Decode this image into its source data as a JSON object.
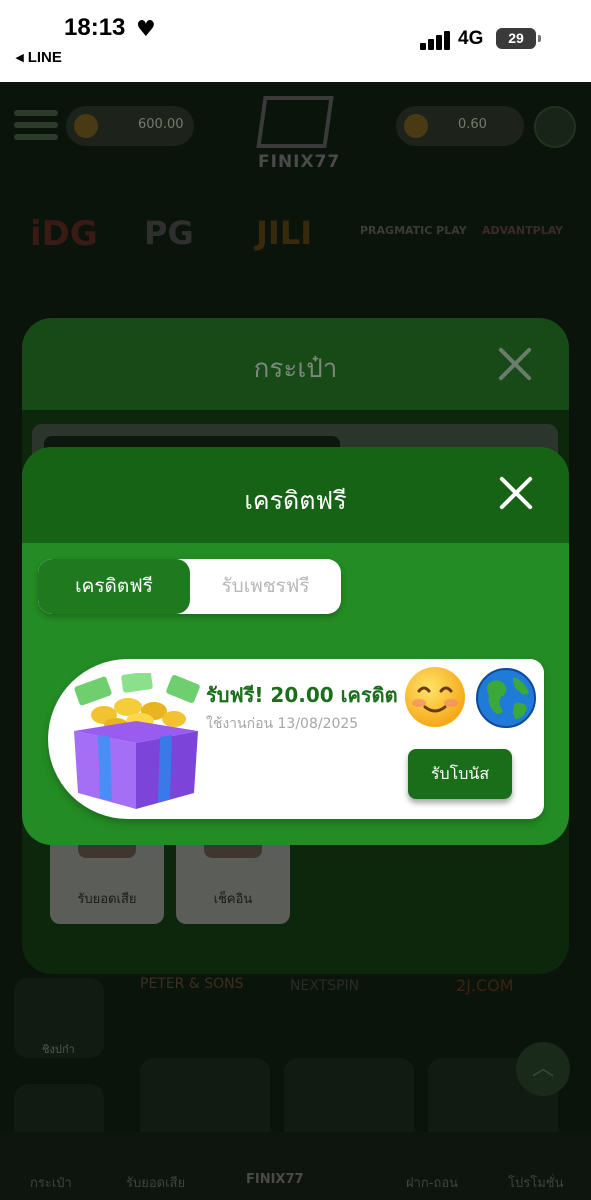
{
  "status_bar": {
    "time": "18:13",
    "back_app": "◂ LINE",
    "network": "4G",
    "battery": "29"
  },
  "background_app": {
    "balance": "600.00",
    "gem_balance": "0.60",
    "logo_text": "FINIX77",
    "providers": [
      "iDG",
      "PG",
      "JILI",
      "PRAGMATIC PLAY",
      "ADVANTPLAY"
    ],
    "game_providers_row2": [
      "PETER & SONS",
      "NEXTSPIN",
      "2J.COM"
    ],
    "side_label": "ชิงปก๋า",
    "bottom_nav": [
      "กระเป๋า",
      "รับยอดเสีย",
      "FINIX77",
      "ฝาก-ถอน",
      "โปรโมชั่น"
    ]
  },
  "wallet_panel": {
    "title": "กระเป๋า",
    "tiles": [
      "รับยอดเสีย",
      "เช็คอิน"
    ]
  },
  "free_credit_modal": {
    "title": "เครดิตฟรี",
    "tabs": [
      {
        "label": "เครดิตฟรี",
        "active": true
      },
      {
        "label": "รับเพชรฟรี",
        "active": false
      }
    ],
    "promo": {
      "title": "รับฟรี! 20.00 เครดิต",
      "subtitle": "ใช้งานก่อน 13/08/2025",
      "claim_button": "รับโบนัส",
      "icons": [
        "gift-box-icon",
        "smiley-icon",
        "globe-icon"
      ]
    }
  },
  "colors": {
    "modal_green": "#248c24",
    "header_green": "#166316",
    "button_green": "#1a6e1a",
    "promo_title": "#1b6e1b"
  }
}
